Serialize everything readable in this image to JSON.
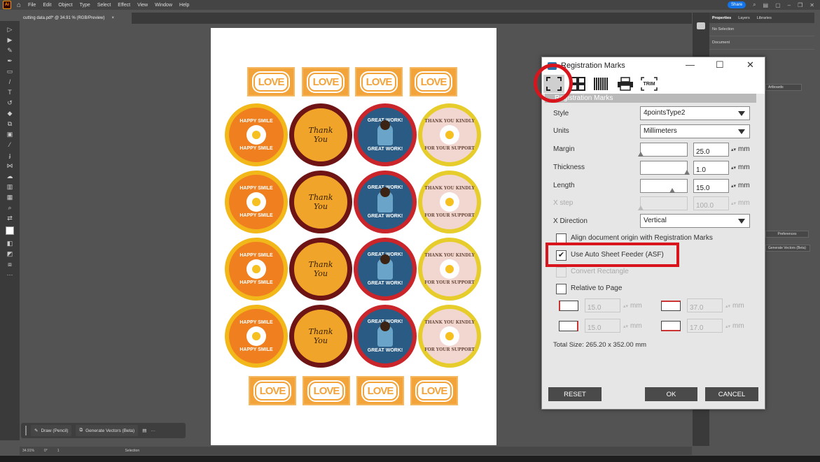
{
  "app": {
    "logo": "Ai",
    "menu": [
      "File",
      "Edit",
      "Object",
      "Type",
      "Select",
      "Effect",
      "View",
      "Window",
      "Help"
    ],
    "share_label": "Share",
    "document_tab": "cutting data.pdf* @ 34.91 % (RGB/Preview)",
    "close_tab": "×"
  },
  "right_panel": {
    "tabs": [
      "Properties",
      "Layers",
      "Libraries"
    ],
    "no_selection": "No Selection",
    "document_label": "Document",
    "artboards_button": "Artboards",
    "preferences_button": "Preferences",
    "bottom_button": "Generate Vectors (Beta)"
  },
  "contextual_bar": {
    "draw_label": "Draw (Pencil)",
    "generate_label": "Generate Vectors (Beta)",
    "more": "···"
  },
  "status_bar": {
    "zoom": "34.91%",
    "rotation": "0°",
    "artboard": "1",
    "tool": "Selection"
  },
  "artboard": {
    "love_label": "LOVE",
    "stickers": {
      "smile": [
        "HAPPY SMILE",
        "HAPPY SMILE"
      ],
      "thank": [
        "Thank",
        "You"
      ],
      "great": [
        "GREAT WORK!",
        "GREAT WORK!"
      ],
      "kindly": [
        "THANK YOU KINDLY",
        "FOR YOUR SUPPORT"
      ]
    }
  },
  "dialog": {
    "title": "Registration Marks",
    "toolbar": [
      "registration-marks",
      "layout",
      "barcode",
      "print",
      "TRIM"
    ],
    "section_header": "Registration Marks",
    "fields": {
      "style": {
        "label": "Style",
        "value": "4pointsType2"
      },
      "units": {
        "label": "Units",
        "value": "Millimeters"
      },
      "margin": {
        "label": "Margin",
        "value": "25.0",
        "unit": "mm"
      },
      "thickness": {
        "label": "Thickness",
        "value": "1.0",
        "unit": "mm"
      },
      "length": {
        "label": "Length",
        "value": "15.0",
        "unit": "mm"
      },
      "xstep": {
        "label": "X step",
        "value": "100.0",
        "unit": "mm"
      },
      "xdirection": {
        "label": "X Direction",
        "value": "Vertical"
      }
    },
    "checkboxes": {
      "align_origin": {
        "label": "Align document origin with Registration Marks",
        "checked": false
      },
      "asf": {
        "label": "Use Auto Sheet Feeder (ASF)",
        "checked": true,
        "mark": "✔"
      },
      "convert_rect": {
        "label": "Convert Rectangle",
        "checked": false
      },
      "relative_page": {
        "label": "Relative to Page",
        "checked": false
      }
    },
    "offsets": {
      "left": "15.0",
      "top": "37.0",
      "right": "15.0",
      "bottom": "17.0",
      "unit": "mm"
    },
    "total_size": "Total Size: 265.20 x 352.00 mm",
    "buttons": {
      "reset": "RESET",
      "ok": "OK",
      "cancel": "CANCEL"
    }
  }
}
